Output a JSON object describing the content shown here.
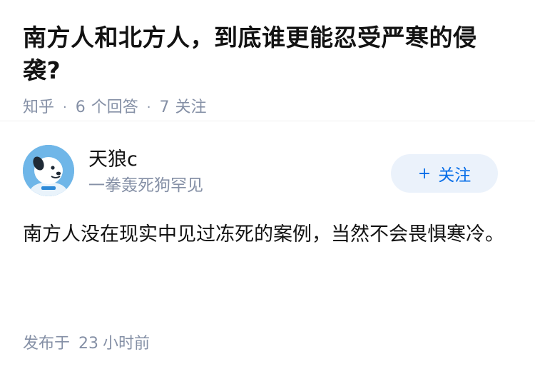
{
  "question": {
    "title": "南方人和北方人，到底谁更能忍受严寒的侵袭?",
    "source": "知乎",
    "answers_count": "6",
    "answers_label": "个回答",
    "follows_count": "7",
    "follows_label": "关注",
    "separator": "·"
  },
  "answer": {
    "author_name": "天狼c",
    "author_bio": "一拳轰死狗罕见",
    "follow_button": {
      "plus": "+",
      "label": "关注"
    },
    "content": "南方人没在现实中见过冻死的案例，当然不会畏惧寒冷。",
    "published_prefix": "发布于",
    "published_num": "23",
    "published_suffix": "小时前"
  },
  "colors": {
    "accent": "#056de8",
    "meta": "#8590a6",
    "follow_bg": "#ebf2fb",
    "avatar_bg": "#6fb6e8"
  }
}
